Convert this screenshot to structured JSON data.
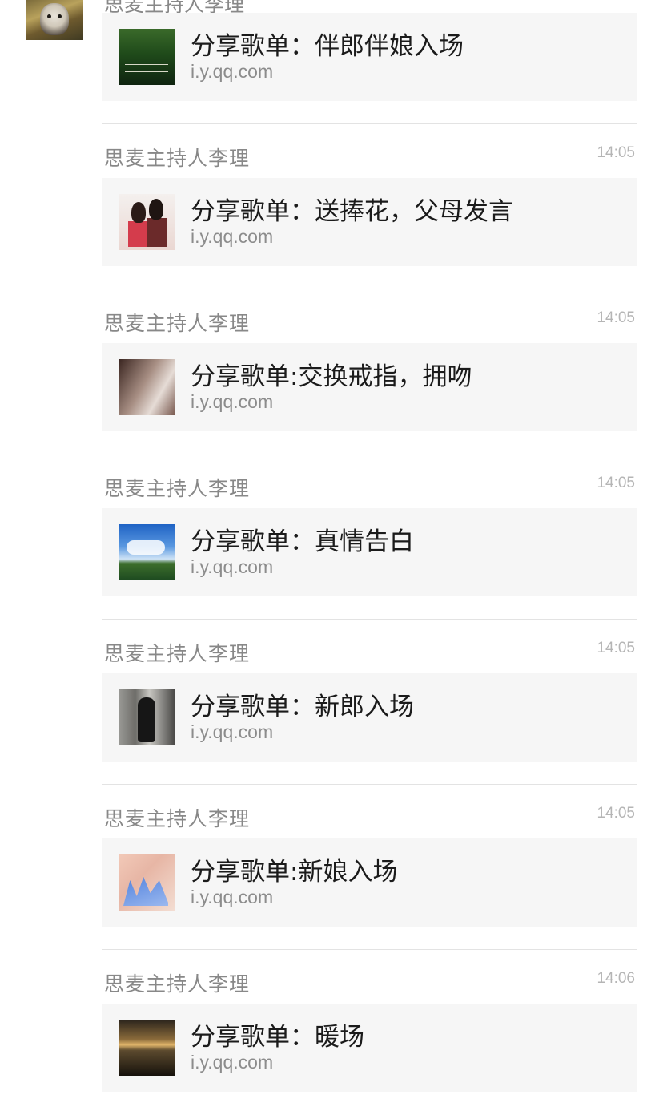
{
  "previous": {
    "sender_partial": "思麦主持人李理"
  },
  "messages": [
    {
      "sender": "",
      "time": "",
      "title": "分享歌单：伴郎伴娘入场",
      "url": "i.y.qq.com",
      "thumb": "forest-album-cover"
    },
    {
      "sender": "思麦主持人李理",
      "time": "14:05",
      "title": "分享歌单：送捧花，父母发言",
      "url": "i.y.qq.com",
      "thumb": "couple-album-cover"
    },
    {
      "sender": "思麦主持人李理",
      "time": "14:05",
      "title": "分享歌单:交换戒指，拥吻",
      "url": "i.y.qq.com",
      "thumb": "ring-album-cover"
    },
    {
      "sender": "思麦主持人李理",
      "time": "14:05",
      "title": "分享歌单：真情告白",
      "url": "i.y.qq.com",
      "thumb": "sky-album-cover"
    },
    {
      "sender": "思麦主持人李理",
      "time": "14:05",
      "title": "分享歌单：新郎入场",
      "url": "i.y.qq.com",
      "thumb": "violinist-album-cover"
    },
    {
      "sender": "思麦主持人李理",
      "time": "14:05",
      "title": "分享歌单:新娘入场",
      "url": "i.y.qq.com",
      "thumb": "painting-album-cover"
    },
    {
      "sender": "思麦主持人李理",
      "time": "14:06",
      "title": "分享歌单：暖场",
      "url": "i.y.qq.com",
      "thumb": "sunset-album-cover"
    }
  ],
  "colors": {
    "card_bg": "#f6f6f6",
    "sender": "#888888",
    "time": "#b5b5b5",
    "title": "#1b1b1b",
    "url": "#8c8c8c"
  }
}
